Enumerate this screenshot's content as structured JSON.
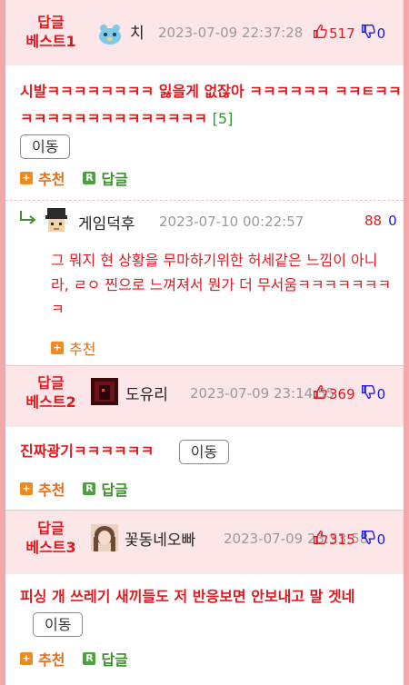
{
  "comments": [
    {
      "rank": "답글\n베스트1",
      "nick": "치",
      "date": "2023-07-09 22:37:28",
      "up": "517",
      "down": "0",
      "text": "시발ㅋㅋㅋㅋㅋㅋㅋㅋ 잃을게 없잖아 ㅋㅋㅋㅋㅋㅋ ㅋㅋㅌㅋㅋㅋㅋㅋㅋㅋㅋㅋㅋㅋㅋㅋㅋㅋㅋ",
      "reply_count": "[5]",
      "move": "이동",
      "recommend": "추천",
      "reply": "답글"
    },
    {
      "rank": "답글\n베스트2",
      "nick": "도유리",
      "date": "2023-07-09 23:14:55",
      "up": "369",
      "down": "0",
      "text": "진짜광기ㅋㅋㅋㅋㅋㅋ",
      "move": "이동",
      "recommend": "추천",
      "reply": "답글"
    },
    {
      "rank": "답글\n베스트3",
      "nick": "꽃동네오빠",
      "date": "2023-07-09 23:53:58",
      "up": "315",
      "down": "0",
      "text": "피싱 개 쓰레기 새끼들도 저 반응보면 안보내고 말 겟네",
      "move": "이동",
      "recommend": "추천",
      "reply": "답글"
    }
  ],
  "reply_item": {
    "nick": "게임덕후",
    "date": "2023-07-10 00:22:57",
    "up": "88",
    "down": "0",
    "text": "그 뭐지 현 상황을 무마하기위한 허세같은 느낌이 아니라, ㄹㅇ 찐으로 느껴져서 뭔가 더 무서움ㅋㅋㅋㅋㅋㅋㅋㅋ",
    "recommend": "추천"
  },
  "icons": {
    "up": "thumbs-up-icon",
    "down": "thumbs-down-icon",
    "plus": "plus-square-icon",
    "reply_badge": "r-badge-icon",
    "reply_arrow": "reply-arrow-icon"
  },
  "colors": {
    "accent_red": "#e0191f",
    "down_blue": "#1a1ad8",
    "header_bg": "#fce6e8",
    "border_pink": "#f3a9ab"
  }
}
